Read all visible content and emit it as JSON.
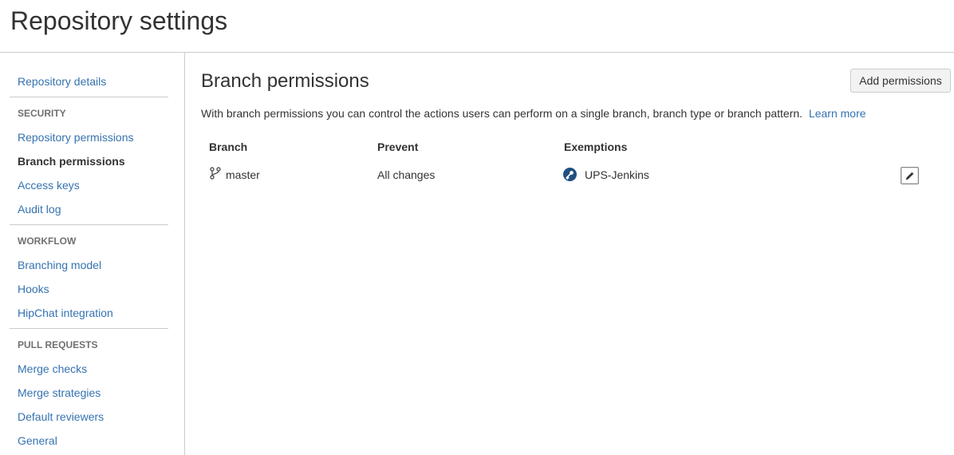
{
  "page": {
    "title": "Repository settings"
  },
  "sidebar": {
    "top_link": "Repository details",
    "sections": [
      {
        "heading": "SECURITY",
        "items": [
          "Repository permissions",
          "Branch permissions",
          "Access keys",
          "Audit log"
        ]
      },
      {
        "heading": "WORKFLOW",
        "items": [
          "Branching model",
          "Hooks",
          "HipChat integration"
        ]
      },
      {
        "heading": "PULL REQUESTS",
        "items": [
          "Merge checks",
          "Merge strategies",
          "Default reviewers",
          "General"
        ]
      }
    ],
    "active_item": "Branch permissions"
  },
  "main": {
    "title": "Branch permissions",
    "add_button": "Add permissions",
    "description": "With branch permissions you can control the actions users can perform on a single branch, branch type or branch pattern.",
    "learn_more": "Learn more",
    "table": {
      "headers": [
        "Branch",
        "Prevent",
        "Exemptions"
      ],
      "rows": [
        {
          "branch": "master",
          "prevent": "All changes",
          "exemption": "UPS-Jenkins"
        }
      ]
    }
  },
  "colors": {
    "link": "#3572b0",
    "text": "#333333",
    "border": "#cccccc",
    "key_icon": "#205081"
  },
  "icons": {
    "branch": "branch-icon",
    "exemption": "access-key-icon",
    "edit": "pencil-icon"
  }
}
